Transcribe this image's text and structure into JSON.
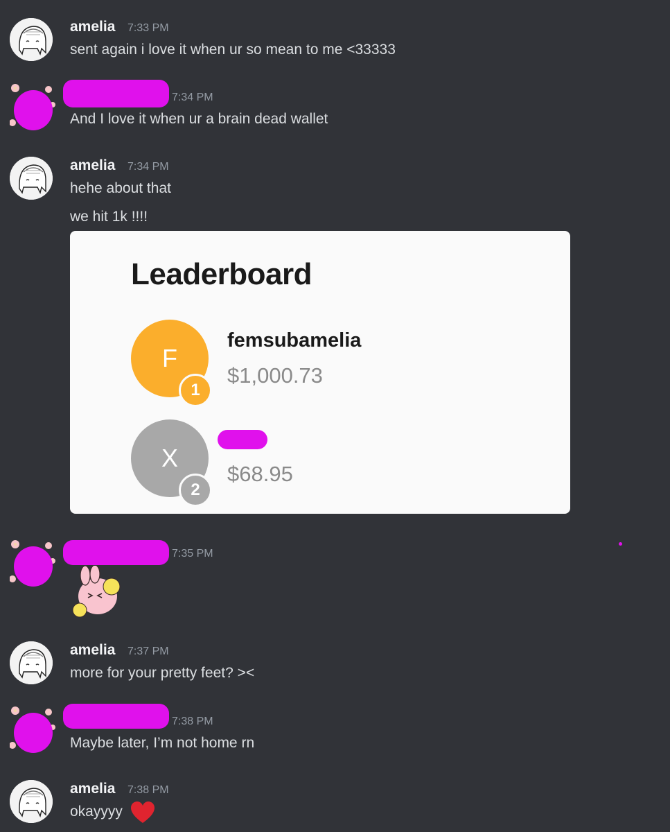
{
  "messages": [
    {
      "author": "amelia",
      "time": "7:33 PM",
      "lines": [
        "sent again i love it when ur so mean to me <33333"
      ]
    },
    {
      "author": "",
      "time": "7:34 PM",
      "lines": [
        "And I love it when ur a brain dead wallet"
      ]
    },
    {
      "author": "amelia",
      "time": "7:34 PM",
      "lines": [
        "hehe about that",
        "we hit 1k !!!!"
      ]
    },
    {
      "author": "",
      "time": "7:35 PM",
      "lines": []
    },
    {
      "author": "amelia",
      "time": "7:37 PM",
      "lines": [
        "more for your pretty feet? ><"
      ]
    },
    {
      "author": "",
      "time": "7:38 PM",
      "lines": [
        "Maybe later, I’m not home rn"
      ]
    },
    {
      "author": "amelia",
      "time": "7:38 PM",
      "lines": [
        "okayyyy"
      ]
    }
  ],
  "leaderboard": {
    "title": "Leaderboard",
    "entries": [
      {
        "initial": "F",
        "rank": "1",
        "name": "femsubamelia",
        "amount": "$1,000.73",
        "color": "#fbae2c"
      },
      {
        "initial": "X",
        "rank": "2",
        "name": "",
        "amount": "$68.95",
        "color": "#a8a8a8"
      }
    ]
  },
  "colors": {
    "background": "#313338",
    "redaction": "#e011ec",
    "heart": "#e0242f"
  },
  "icons": {
    "avatar_amelia": "anime-girl-sketch-avatar",
    "avatar_other": "flower-frame-avatar",
    "sticker": "pink-bunny-cheer-sticker",
    "reaction": "red-heart-emoji"
  }
}
